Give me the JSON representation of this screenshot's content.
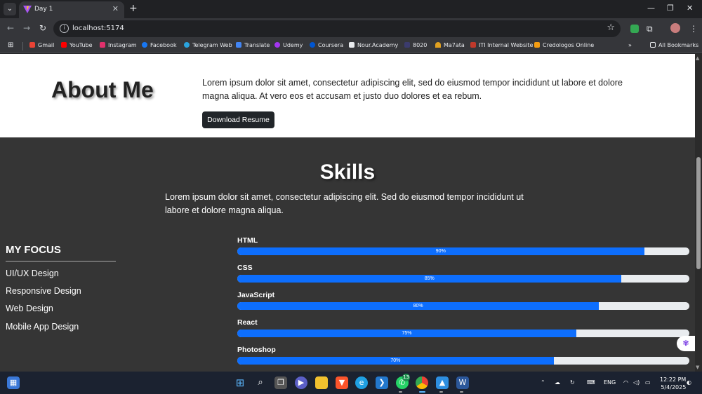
{
  "browser": {
    "tab_title": "Day 1",
    "url": "localhost:5174",
    "all_bookmarks_label": "All Bookmarks",
    "bookmarks": [
      {
        "label": "Gmail",
        "color": "#ea4335"
      },
      {
        "label": "YouTube",
        "color": "#ff0000"
      },
      {
        "label": "Instagram",
        "color": "#e1306c"
      },
      {
        "label": "Facebook",
        "color": "#1877f2"
      },
      {
        "label": "Telegram Web",
        "color": "#2aa3de"
      },
      {
        "label": "Translate",
        "color": "#4285f4"
      },
      {
        "label": "Udemy",
        "color": "#a435f0"
      },
      {
        "label": "Coursera",
        "color": "#0056d2"
      },
      {
        "label": "Nour.Academy",
        "color": "#e8eaed"
      },
      {
        "label": "8020",
        "color": "#3b3b6d"
      },
      {
        "label": "Ma7ata",
        "color": "#e0a020"
      },
      {
        "label": "ITI Internal Website",
        "color": "#c0392b"
      },
      {
        "label": "Credologos Online",
        "color": "#f39c12"
      }
    ]
  },
  "about": {
    "title": "About Me",
    "text": "Lorem ipsum dolor sit amet, consectetur adipiscing elit, sed do eiusmod tempor incididunt ut labore et dolore magna aliqua. At vero eos et accusam et justo duo dolores et ea rebum.",
    "button": "Download Resume"
  },
  "skills": {
    "title": "Skills",
    "text": "Lorem ipsum dolor sit amet, consectetur adipiscing elit. Sed do eiusmod tempor incididunt ut labore et dolore magna aliqua.",
    "focus_title": "MY FOCUS",
    "focus_items": [
      "UI/UX Design",
      "Responsive Design",
      "Web Design",
      "Mobile App Design"
    ],
    "items": [
      {
        "name": "HTML",
        "percent": 90,
        "label": "90%"
      },
      {
        "name": "CSS",
        "percent": 85,
        "label": "85%"
      },
      {
        "name": "JavaScript",
        "percent": 80,
        "label": "80%"
      },
      {
        "name": "React",
        "percent": 75,
        "label": "75%"
      },
      {
        "name": "Photoshop",
        "percent": 70,
        "label": "70%"
      }
    ],
    "bar_color": "#0d6efd"
  },
  "taskbar": {
    "lang": "ENG",
    "time": "12:22 PM",
    "date": "5/4/2025",
    "whatsapp_badge": "13"
  }
}
